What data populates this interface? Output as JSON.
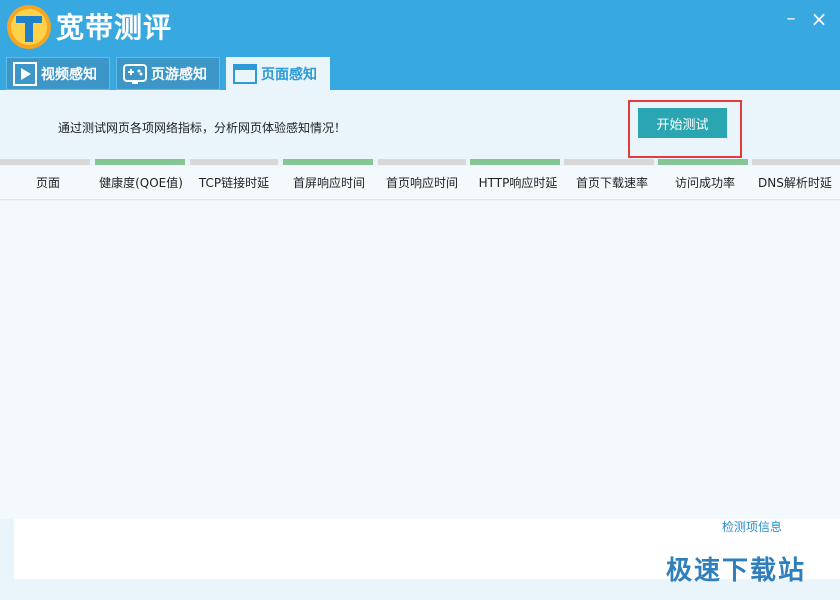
{
  "app": {
    "title": "宽带测评",
    "minimize": "–",
    "close": "×"
  },
  "tabs": [
    {
      "label": "视频感知",
      "icon": "play-icon"
    },
    {
      "label": "页游感知",
      "icon": "gamepad-icon"
    },
    {
      "label": "页面感知",
      "icon": "browser-window-icon",
      "selected": true
    }
  ],
  "main": {
    "description": "通过测试网页各项网络指标，分析网页体验感知情况！",
    "start_button": "开始测试",
    "columns": [
      "页面",
      "健康度(QOE值)",
      "TCP链接时延",
      "首屏响应时间",
      "首页响应时间",
      "HTTP响应时延",
      "首页下载速率",
      "访问成功率",
      "DNS解析时延"
    ],
    "info_link": "检测项信息"
  },
  "watermark": "极速下载站",
  "colors": {
    "titlebar": "#38a9e0",
    "accent_button": "#2aa6b2",
    "highlight_frame": "#e33b3b",
    "strip_green": "#86c696",
    "strip_gray": "#d8d8d8"
  }
}
